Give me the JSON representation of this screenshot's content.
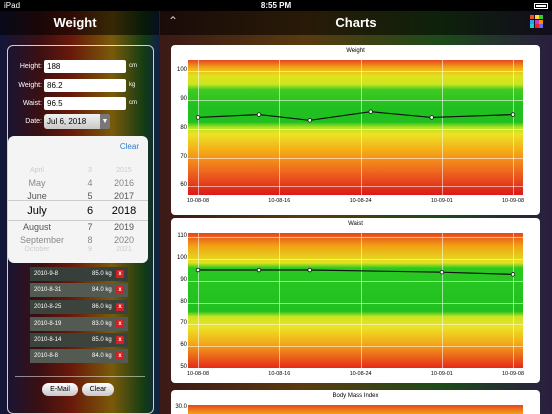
{
  "status_bar": {
    "carrier": "iPad",
    "time": "8:55 PM"
  },
  "left_panel": {
    "title": "Weight",
    "height": {
      "label": "Height:",
      "value": "188",
      "unit": "cm"
    },
    "weight": {
      "label": "Weight:",
      "value": "86.2",
      "unit": "kg"
    },
    "waist": {
      "label": "Waist:",
      "value": "96.5",
      "unit": "cm"
    },
    "date": {
      "label": "Date:",
      "value": "Jul 6, 2018"
    },
    "picker": {
      "clear_label": "Clear",
      "months": [
        "April",
        "May",
        "June",
        "July",
        "August",
        "September",
        "October"
      ],
      "days": [
        "3",
        "4",
        "5",
        "6",
        "7",
        "8",
        "9"
      ],
      "years": [
        "2015",
        "2016",
        "2017",
        "2018",
        "2019",
        "2020",
        "2021"
      ]
    },
    "entries": [
      {
        "date": "2010-9-8",
        "weight": "85.0 kg"
      },
      {
        "date": "2010-8-31",
        "weight": "84.0 kg"
      },
      {
        "date": "2010-8-25",
        "weight": "86.0 kg"
      },
      {
        "date": "2010-8-19",
        "weight": "83.0 kg"
      },
      {
        "date": "2010-8-14",
        "weight": "85.0 kg"
      },
      {
        "date": "2010-8-8",
        "weight": "84.0 kg"
      }
    ],
    "delete_glyph": "x",
    "buttons": {
      "email": "E-Mail",
      "clear": "Clear"
    }
  },
  "right_panel": {
    "title": "Charts"
  },
  "colors": {
    "accent_blue": "#2a7bd4",
    "delete_red": "#d42020"
  },
  "chart_data": [
    {
      "type": "line",
      "title": "Weight",
      "x": [
        "10-08-08",
        "10-08-14",
        "10-08-19",
        "10-08-25",
        "10-08-31",
        "10-09-08"
      ],
      "x_ticks": [
        "10-08-08",
        "10-08-16",
        "10-08-24",
        "10-09-01",
        "10-09-08"
      ],
      "values": [
        84,
        85,
        83,
        86,
        84,
        85
      ],
      "y_ticks": [
        60,
        70,
        80,
        90,
        100
      ],
      "ylim": [
        57,
        104
      ]
    },
    {
      "type": "line",
      "title": "Waist",
      "x": [
        "10-08-08",
        "10-08-14",
        "10-08-19",
        "10-09-01",
        "10-09-08"
      ],
      "x_ticks": [
        "10-08-08",
        "10-08-16",
        "10-08-24",
        "10-09-01",
        "10-09-08"
      ],
      "values": [
        95,
        95,
        95,
        94,
        93
      ],
      "y_ticks": [
        50,
        60,
        70,
        80,
        90,
        100,
        110
      ],
      "ylim": [
        50,
        112
      ]
    },
    {
      "type": "line",
      "title": "Body Mass Index",
      "y_ticks": [
        30.0
      ]
    }
  ]
}
